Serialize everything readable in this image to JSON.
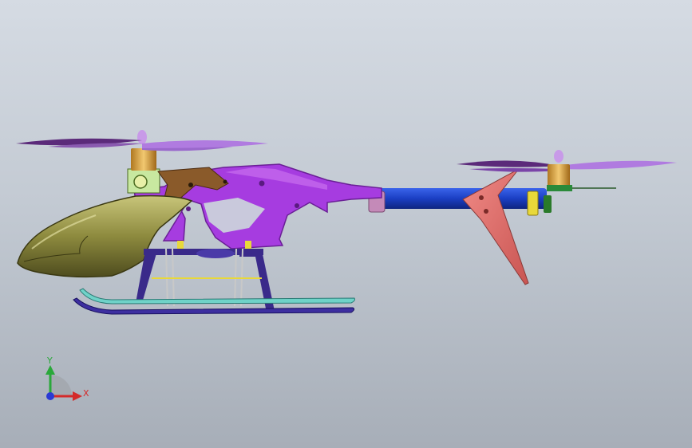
{
  "viewport": {
    "background_top": "#d5dbe3",
    "background_bottom": "#a7aeb8"
  },
  "model": {
    "colors": {
      "frame": "#a63ce0",
      "frame_dark": "#7a25ad",
      "canopy": "#8d8a3e",
      "canopy_highlight": "#c8c57a",
      "tail_boom": "#1b3fc4",
      "tail_fin": "#e0716e",
      "landing_gear": "#3a2a8a",
      "skid_upper": "#6fd2c8",
      "skid_lower": "#3d2fa0",
      "rotor_blade": "#b07be0",
      "rotor_blade_dark": "#5b2a7a",
      "motor": "#d9a84a",
      "bracket": "#8a5a2a",
      "mount": "#c8e8a0",
      "clamp": "#e8d83a"
    }
  },
  "triad": {
    "x_label": "X",
    "y_label": "Y",
    "x_color": "#d42a2a",
    "y_color": "#2aa83a",
    "z_color": "#2a3ad4",
    "icon": "coordinate-axes-icon"
  }
}
